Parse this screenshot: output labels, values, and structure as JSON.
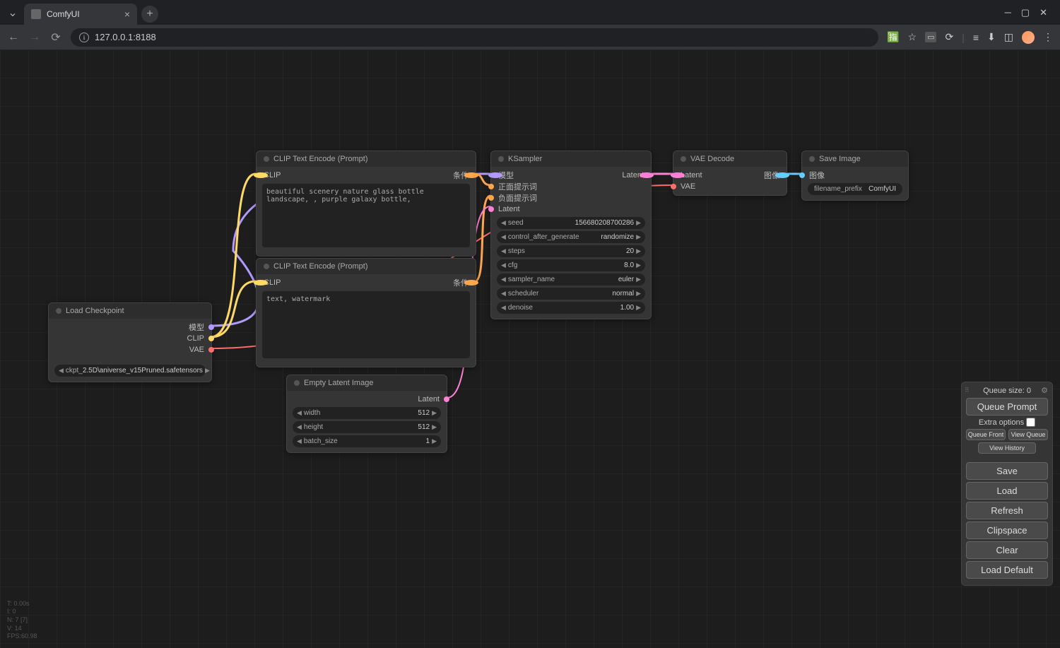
{
  "browser": {
    "tab_title": "ComfyUI",
    "url": "127.0.0.1:8188"
  },
  "nodes": {
    "load_checkpoint": {
      "title": "Load Checkpoint",
      "outputs": {
        "model": "模型",
        "clip": "CLIP",
        "vae": "VAE"
      },
      "widget": {
        "label": "ckpt_",
        "value": "2.5D\\aniverse_v15Pruned.safetensors"
      }
    },
    "clip_pos": {
      "title": "CLIP Text Encode (Prompt)",
      "input": "CLIP",
      "output": "条件",
      "text": "beautiful scenery nature glass bottle landscape, , purple galaxy bottle,"
    },
    "clip_neg": {
      "title": "CLIP Text Encode (Prompt)",
      "input": "CLIP",
      "output": "条件",
      "text": "text, watermark"
    },
    "empty_latent": {
      "title": "Empty Latent Image",
      "output": "Latent",
      "widgets": [
        {
          "label": "width",
          "value": "512"
        },
        {
          "label": "height",
          "value": "512"
        },
        {
          "label": "batch_size",
          "value": "1"
        }
      ]
    },
    "ksampler": {
      "title": "KSampler",
      "inputs": {
        "model": "模型",
        "pos": "正面提示词",
        "neg": "负面提示词",
        "latent": "Latent"
      },
      "output": "Latent",
      "widgets": [
        {
          "label": "seed",
          "value": "156680208700286"
        },
        {
          "label": "control_after_generate",
          "value": "randomize"
        },
        {
          "label": "steps",
          "value": "20"
        },
        {
          "label": "cfg",
          "value": "8.0"
        },
        {
          "label": "sampler_name",
          "value": "euler"
        },
        {
          "label": "scheduler",
          "value": "normal"
        },
        {
          "label": "denoise",
          "value": "1.00"
        }
      ]
    },
    "vae_decode": {
      "title": "VAE Decode",
      "inputs": {
        "latent": "Latent",
        "vae": "VAE"
      },
      "output": "图像"
    },
    "save_image": {
      "title": "Save Image",
      "input": "图像",
      "widget": {
        "label": "filename_prefix",
        "value": "ComfyUI"
      }
    }
  },
  "panel": {
    "queue_size": "Queue size: 0",
    "queue_prompt": "Queue Prompt",
    "extra_options": "Extra options",
    "queue_front": "Queue Front",
    "view_queue": "View Queue",
    "view_history": "View History",
    "save": "Save",
    "load": "Load",
    "refresh": "Refresh",
    "clipspace": "Clipspace",
    "clear": "Clear",
    "load_default": "Load Default"
  },
  "stats": {
    "l1": "T: 0.00s",
    "l2": "I: 0",
    "l3": "N: 7 [7]",
    "l4": "V: 14",
    "l5": "FPS:60.98"
  }
}
